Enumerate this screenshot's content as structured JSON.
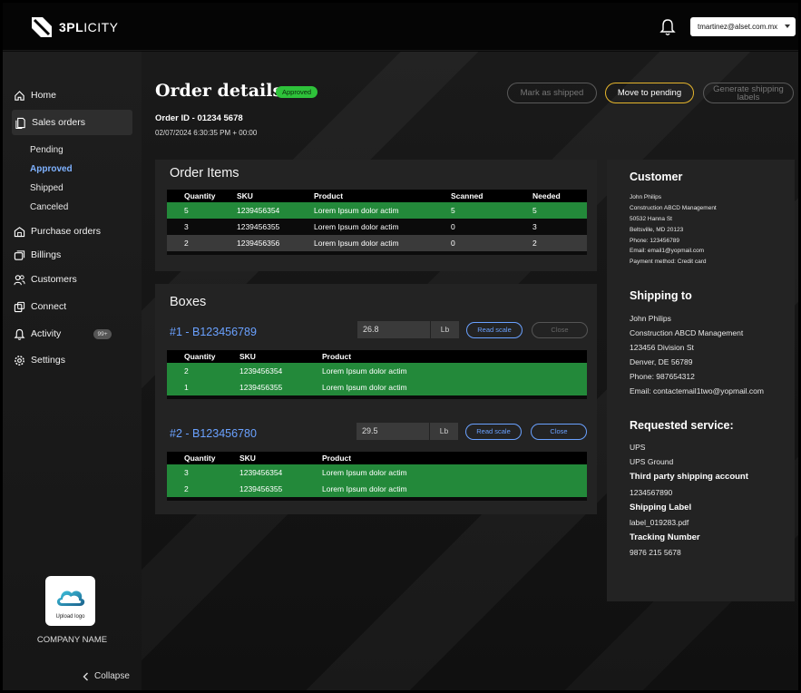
{
  "brand": {
    "logo_text_bold": "3PL",
    "logo_text_light": "ICITY"
  },
  "header": {
    "user_email": "tmartinez@alset.com.mx"
  },
  "sidebar": {
    "items": [
      {
        "label": "Home",
        "icon": "home-icon"
      },
      {
        "label": "Sales orders",
        "icon": "document-icon"
      },
      {
        "label": "Purchase orders",
        "icon": "building-icon"
      },
      {
        "label": "Billings",
        "icon": "card-icon"
      },
      {
        "label": "Customers",
        "icon": "users-icon"
      },
      {
        "label": "Connect",
        "icon": "connect-icon"
      },
      {
        "label": "Activity",
        "icon": "bell-icon",
        "badge": "99+"
      },
      {
        "label": "Settings",
        "icon": "gear-icon"
      }
    ],
    "sub_items": [
      "Pending",
      "Approved",
      "Shipped",
      "Canceled"
    ],
    "selected_sub": "Approved",
    "upload_label": "Upload logo",
    "company_name": "COMPANY NAME",
    "collapse_label": "Collapse"
  },
  "order": {
    "title": "Order details",
    "status": "Approved",
    "id_label": "Order ID - 01234 5678",
    "date": "02/07/2024 6:30:35 PM + 00:00"
  },
  "actions": {
    "mark_shipped": "Mark as shipped",
    "move_pending": "Move to pending",
    "generate_labels": "Generate shipping labels"
  },
  "order_items": {
    "title": "Order Items",
    "columns": [
      "Quantity",
      "SKU",
      "Product",
      "Scanned",
      "Needed"
    ],
    "rows": [
      {
        "qty": "5",
        "sku": "1239456354",
        "product": "Lorem Ipsum dolor actim",
        "scanned": "5",
        "needed": "5"
      },
      {
        "qty": "3",
        "sku": "1239456355",
        "product": "Lorem Ipsum dolor actim",
        "scanned": "0",
        "needed": "3"
      },
      {
        "qty": "2",
        "sku": "1239456356",
        "product": "Lorem Ipsum dolor actim",
        "scanned": "0",
        "needed": "2"
      }
    ]
  },
  "boxes": {
    "title": "Boxes",
    "columns": [
      "Quantity",
      "SKU",
      "Product"
    ],
    "unit": "Lb",
    "read_scale": "Read scale",
    "close": "Close",
    "list": [
      {
        "name": "#1 - B123456789",
        "weight": "26.8",
        "rows": [
          {
            "qty": "2",
            "sku": "1239456354",
            "product": "Lorem Ipsum dolor actim"
          },
          {
            "qty": "1",
            "sku": "1239456355",
            "product": "Lorem Ipsum dolor actim"
          }
        ]
      },
      {
        "name": "#2 - B123456780",
        "weight": "29.5",
        "rows": [
          {
            "qty": "3",
            "sku": "1239456354",
            "product": "Lorem Ipsum dolor actim"
          },
          {
            "qty": "2",
            "sku": "1239456355",
            "product": "Lorem Ipsum dolor actim"
          }
        ]
      }
    ]
  },
  "customer": {
    "title": "Customer",
    "lines": [
      "John Philips",
      "Construction ABCD Management",
      "50532 Hanna St",
      "Beltsville, MD 20123",
      "Phone: 123456789",
      "Email: email1@yopmail.com",
      "Payment method: Credit card"
    ]
  },
  "shipping": {
    "title": "Shipping to",
    "lines": [
      "John Philips",
      "Construction ABCD Management",
      "123456 Division St",
      "Denver, DE 56789",
      "Phone: 987654312",
      "Email: contactemail1two@yopmail.com"
    ]
  },
  "service": {
    "title": "Requested service:",
    "carrier": "UPS",
    "level": "UPS Ground",
    "third_party_label": "Third party shipping account",
    "third_party_value": "1234567890",
    "shipping_label_label": "Shipping Label",
    "shipping_label_value": "label_019283.pdf",
    "tracking_label": "Tracking Number",
    "tracking_value": "9876 215 5678"
  },
  "colors": {
    "accent_green": "#23893a",
    "pill_green": "#2ec23a",
    "link_blue": "#6aa1ff",
    "pending_yellow": "#e5b52c"
  }
}
